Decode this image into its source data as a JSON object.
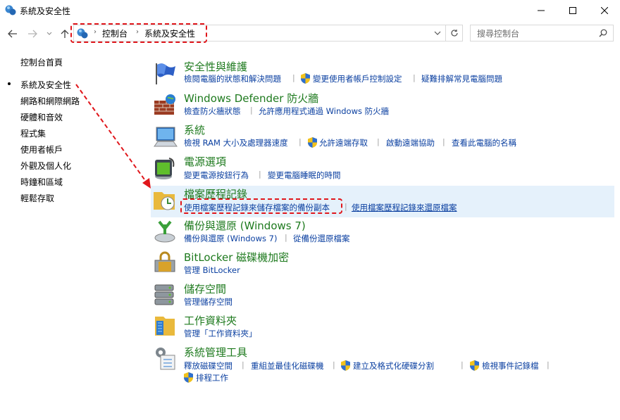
{
  "window": {
    "title": "系統及安全性"
  },
  "address": {
    "crumbs": [
      "控制台",
      "系統及安全性"
    ]
  },
  "search": {
    "placeholder": "搜尋控制台"
  },
  "sidebar": {
    "home": "控制台首頁",
    "items": [
      {
        "label": "系統及安全性",
        "current": true
      },
      {
        "label": "網路和網際網路"
      },
      {
        "label": "硬體和音效"
      },
      {
        "label": "程式集"
      },
      {
        "label": "使用者帳戶"
      },
      {
        "label": "外觀及個人化"
      },
      {
        "label": "時鐘和區域"
      },
      {
        "label": "輕鬆存取"
      }
    ]
  },
  "categories": [
    {
      "title": "安全性與維護",
      "icon": "flag-icon",
      "links": [
        "檢閱電腦的狀態和解決問題",
        "變更使用者帳戶控制設定",
        "疑難排解常見電腦問題"
      ]
    },
    {
      "title": "Windows Defender 防火牆",
      "icon": "firewall-icon",
      "links": [
        "檢查防火牆狀態",
        "允許應用程式通過 Windows 防火牆"
      ]
    },
    {
      "title": "系統",
      "icon": "computer-icon",
      "links": [
        "檢視 RAM 大小及處理器速度",
        "允許遠端存取",
        "啟動遠端協助",
        "查看此電腦的名稱"
      ]
    },
    {
      "title": "電源選項",
      "icon": "battery-icon",
      "links": [
        "變更電源按鈕行為",
        "變更電腦睡眠的時間"
      ]
    },
    {
      "title": "檔案歷程記錄",
      "icon": "file-history-icon",
      "links": [
        "使用檔案歷程記錄來儲存檔案的備份副本",
        "使用檔案歷程記錄來還原檔案"
      ]
    },
    {
      "title": "備份與還原 (Windows 7)",
      "icon": "backup-icon",
      "links": [
        "備份與還原 (Windows 7)",
        "從備份還原檔案"
      ]
    },
    {
      "title": "BitLocker 磁碟機加密",
      "icon": "bitlocker-icon",
      "links": [
        "管理 BitLocker"
      ]
    },
    {
      "title": "儲存空間",
      "icon": "storage-icon",
      "links": [
        "管理儲存空間"
      ]
    },
    {
      "title": "工作資料夾",
      "icon": "work-folders-icon",
      "links": [
        "管理「工作資料夾」"
      ]
    },
    {
      "title": "系統管理工具",
      "icon": "admin-tools-icon",
      "links": [
        "釋放磁碟空間",
        "重組並最佳化磁碟機",
        "建立及格式化硬碟分割",
        "檢視事件記錄檔",
        "排程工作"
      ]
    }
  ],
  "colors": {
    "title_green": "#1e7a1e",
    "link_blue": "#0a3fa0",
    "highlight_bg": "#e5f1fb",
    "annotation_red": "#e0161b"
  }
}
